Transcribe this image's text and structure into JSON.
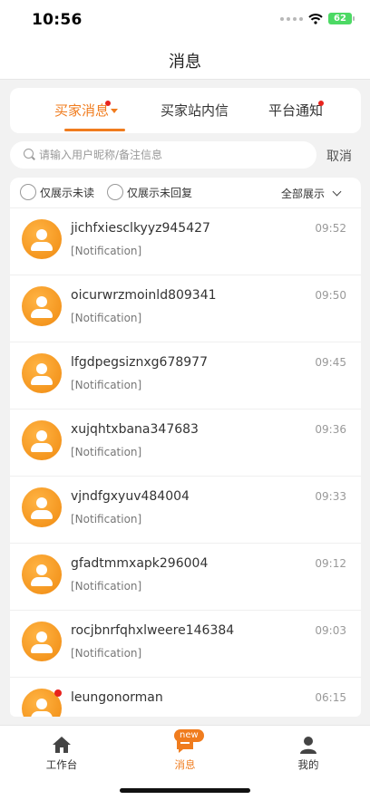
{
  "status_bar": {
    "time": "10:56",
    "battery": "62"
  },
  "nav": {
    "title": "消息"
  },
  "tabs": [
    {
      "label": "买家消息",
      "active": true,
      "has_dot": true
    },
    {
      "label": "买家站内信",
      "active": false,
      "has_dot": false
    },
    {
      "label": "平台通知",
      "active": false,
      "has_dot": true
    }
  ],
  "search": {
    "placeholder": "请输入用户昵称/备注信息",
    "value": "",
    "cancel_label": "取消"
  },
  "filters": {
    "unread_label": "仅展示未读",
    "unreplied_label": "仅展示未回复",
    "show_all_label": "全部展示"
  },
  "conversations": [
    {
      "name": "jichfxiesclkyyz945427",
      "time": "09:52",
      "preview": "[Notification]"
    },
    {
      "name": "oicurwrzmoinld809341",
      "time": "09:50",
      "preview": "[Notification]"
    },
    {
      "name": "lfgdpegsiznxg678977",
      "time": "09:45",
      "preview": "[Notification]"
    },
    {
      "name": "xujqhtxbana347683",
      "time": "09:36",
      "preview": "[Notification]"
    },
    {
      "name": "vjndfgxyuv484004",
      "time": "09:33",
      "preview": "[Notification]"
    },
    {
      "name": "gfadtmmxapk296004",
      "time": "09:12",
      "preview": "[Notification]"
    },
    {
      "name": "rocjbnrfqhxlweere146384",
      "time": "09:03",
      "preview": "[Notification]"
    },
    {
      "name": "leungonorman",
      "time": "06:15",
      "preview": "",
      "unread": true
    }
  ],
  "tab_bar": {
    "items": [
      {
        "label": "工作台",
        "icon": "home-icon"
      },
      {
        "label": "消息",
        "icon": "message-icon",
        "badge": "new"
      },
      {
        "label": "我的",
        "icon": "profile-icon"
      }
    ]
  },
  "colors": {
    "accent": "#f07c1e",
    "dot": "#e8231d"
  }
}
